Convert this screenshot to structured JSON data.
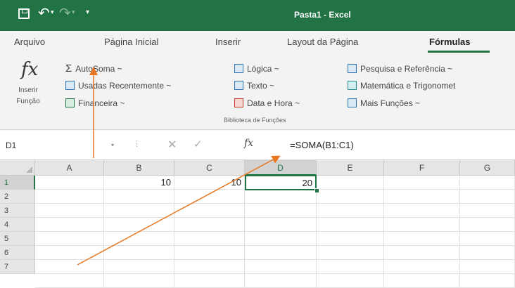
{
  "title_bar": {
    "title": "Pasta1 - Excel",
    "undo_icon": "↶",
    "redo_icon": "↷",
    "caret": "▾",
    "qat_icon": "▾"
  },
  "tabs": [
    "Arquivo",
    "Página Inicial",
    "Inserir",
    "Layout da Página",
    "Fórmulas"
  ],
  "ribbon": {
    "insert_function": {
      "icon": "fx",
      "line1": "Inserir",
      "line2": "Função"
    },
    "commands": [
      {
        "label": "AutoSoma ~",
        "icon": "Σ"
      },
      {
        "label": "Usadas Recentemente ~",
        "icon": "recent-icon"
      },
      {
        "label": "Financeira ~",
        "icon": "financial-icon"
      },
      {
        "label": "Lógica ~",
        "icon": "logical-icon"
      },
      {
        "label": "Texto ~",
        "icon": "text-icon"
      },
      {
        "label": "Data e Hora ~",
        "icon": "datetime-icon"
      },
      {
        "label": "Pesquisa e Referência ~",
        "icon": "lookup-icon"
      },
      {
        "label": "Matemática e Trigonomet",
        "icon": "math-icon"
      },
      {
        "label": "Mais Funções ~",
        "icon": "more-functions-icon"
      }
    ],
    "group_label": "Biblioteca de Funções"
  },
  "formula_bar": {
    "name_box": "D1",
    "name_caret": "▾",
    "separator": "⋮",
    "cancel_icon": "✕",
    "enter_icon": "✓",
    "fx": "fx",
    "formula": "=SOMA(B1:C1)"
  },
  "grid": {
    "columns": [
      "A",
      "B",
      "C",
      "D",
      "E",
      "F",
      "G"
    ],
    "rows": [
      "1",
      "2",
      "3",
      "4",
      "5",
      "6",
      "7"
    ],
    "cells": {
      "B1": "10",
      "C1": "10",
      "D1": "20"
    },
    "active_cell": "D1"
  },
  "colors": {
    "brand": "#217346",
    "arrow": "#e87722"
  }
}
